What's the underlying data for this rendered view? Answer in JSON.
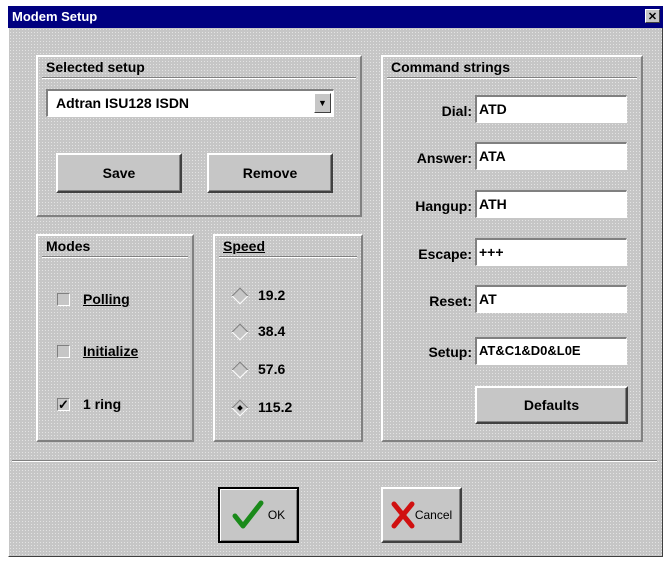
{
  "window": {
    "title": "Modem Setup",
    "close_glyph": "✕"
  },
  "selected_setup": {
    "title": "Selected setup",
    "value": "Adtran ISU128 ISDN",
    "save_label": "Save",
    "remove_label": "Remove"
  },
  "modes": {
    "title": "Modes",
    "items": [
      {
        "label": "Polling",
        "checked": false
      },
      {
        "label": "Initialize",
        "checked": false
      },
      {
        "label": "1 ring",
        "checked": true
      }
    ]
  },
  "speed": {
    "title": "Speed",
    "options": [
      {
        "label": "19.2",
        "selected": false
      },
      {
        "label": "38.4",
        "selected": false
      },
      {
        "label": "57.6",
        "selected": false
      },
      {
        "label": "115.2",
        "selected": true
      }
    ]
  },
  "command_strings": {
    "title": "Command strings",
    "fields": [
      {
        "label": "Dial:",
        "value": "ATD"
      },
      {
        "label": "Answer:",
        "value": "ATA"
      },
      {
        "label": "Hangup:",
        "value": "ATH"
      },
      {
        "label": "Escape:",
        "value": "+++"
      },
      {
        "label": "Reset:",
        "value": "AT"
      },
      {
        "label": "Setup:",
        "value": "AT&C1&D0&L0E"
      }
    ],
    "defaults_label": "Defaults"
  },
  "footer": {
    "ok_label": "OK",
    "cancel_label": "Cancel"
  },
  "colors": {
    "title_bar": "#000080",
    "face": "#c6c6c6",
    "ok_check": "#1a8a1a",
    "cancel_x": "#d01010"
  },
  "icons": {
    "ok": "checkmark-icon",
    "cancel": "x-icon"
  }
}
